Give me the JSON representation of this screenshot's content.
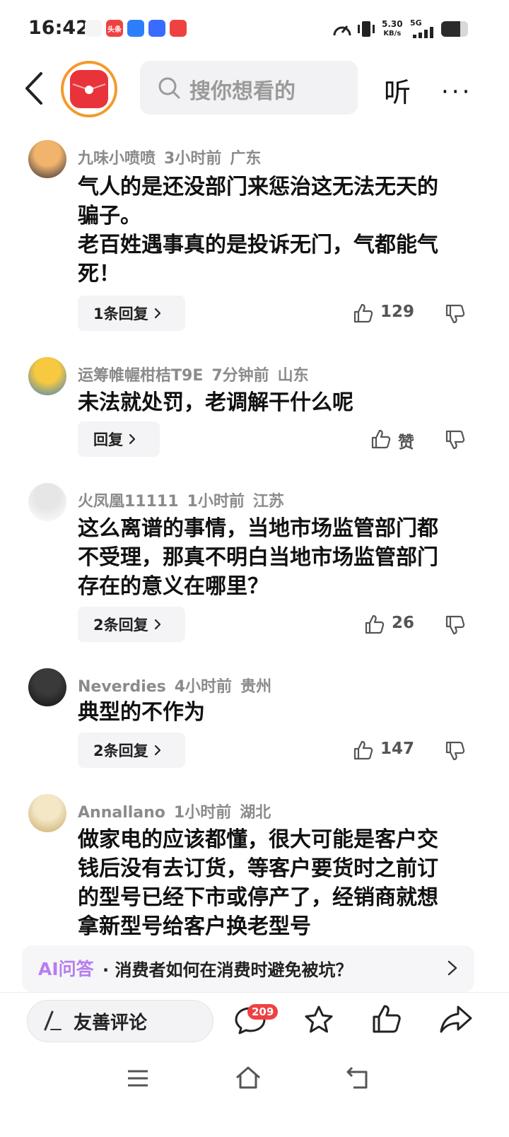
{
  "status_bar": {
    "time": "16:42",
    "app_icons": [
      {
        "name": "avatar-app-icon",
        "color": "#f5f5f5",
        "label": ""
      },
      {
        "name": "toutiao-app-icon",
        "color": "#f04142",
        "label": "头条"
      },
      {
        "name": "blue-app-icon",
        "color": "#2d7ff9",
        "label": ""
      },
      {
        "name": "baidu-app-icon",
        "color": "#3a6bff",
        "label": ""
      },
      {
        "name": "douyin-app-icon",
        "color": "#f04142",
        "label": ""
      }
    ],
    "net_speed": "5.30",
    "net_unit": "KB/s",
    "signal_label": "5G",
    "battery_level": 0.7
  },
  "top_bar": {
    "search_placeholder": "搜你想看的",
    "listen_label": "听",
    "more_label": "···"
  },
  "comments": [
    {
      "username": "九味小喷喷",
      "time": "3小时前",
      "location": "广东",
      "text_lines": [
        "气人的是还没部门来惩治这无法无天的",
        "骗子。",
        "老百姓遇事真的是投诉无门，气都能气",
        "死！"
      ],
      "reply_label": "1条回复",
      "likes": "129",
      "avatar_colors": [
        "#f2b46c",
        "#2a2a3a"
      ]
    },
    {
      "username": "运筹帷幄柑桔T9E",
      "time": "7分钟前",
      "location": "山东",
      "text_lines": [
        "未法就处罚，老调解干什么呢"
      ],
      "reply_label": "回复",
      "likes": "赞",
      "avatar_colors": [
        "#f6c940",
        "#3b7fc4"
      ]
    },
    {
      "username": "火凤凰11111",
      "time": "1小时前",
      "location": "江苏",
      "text_lines": [
        "这么离谱的事情，当地市场监管部门都",
        "不受理，那真不明白当地市场监管部门",
        "存在的意义在哪里？"
      ],
      "reply_label": "2条回复",
      "likes": "26",
      "avatar_colors": [
        "#e6e6e6",
        "#ffffff"
      ]
    },
    {
      "username": "Neverdies",
      "time": "4小时前",
      "location": "贵州",
      "text_lines": [
        "典型的不作为"
      ],
      "reply_label": "2条回复",
      "likes": "147",
      "avatar_colors": [
        "#3a3a3a",
        "#111111"
      ]
    },
    {
      "username": "Annallano",
      "time": "1小时前",
      "location": "湖北",
      "text_lines": [
        "做家电的应该都懂，很大可能是客户交",
        "钱后没有去订货，等客户要货时之前订",
        "的型号已经下市或停产了，经销商就想",
        "拿新型号给客户换老型号"
      ],
      "reply_label": "",
      "likes": "",
      "avatar_colors": [
        "#f3e7c6",
        "#c9a766"
      ]
    }
  ],
  "ai_bar": {
    "tag": "AI问答",
    "question": "· 消费者如何在消费时避免被坑？"
  },
  "bottom_bar": {
    "comment_placeholder": "友善评论",
    "comment_count": "209"
  },
  "colors": {
    "accent_red": "#f04142",
    "logo_ring": "#f39a2b",
    "ai_purple": "#b77df0"
  }
}
